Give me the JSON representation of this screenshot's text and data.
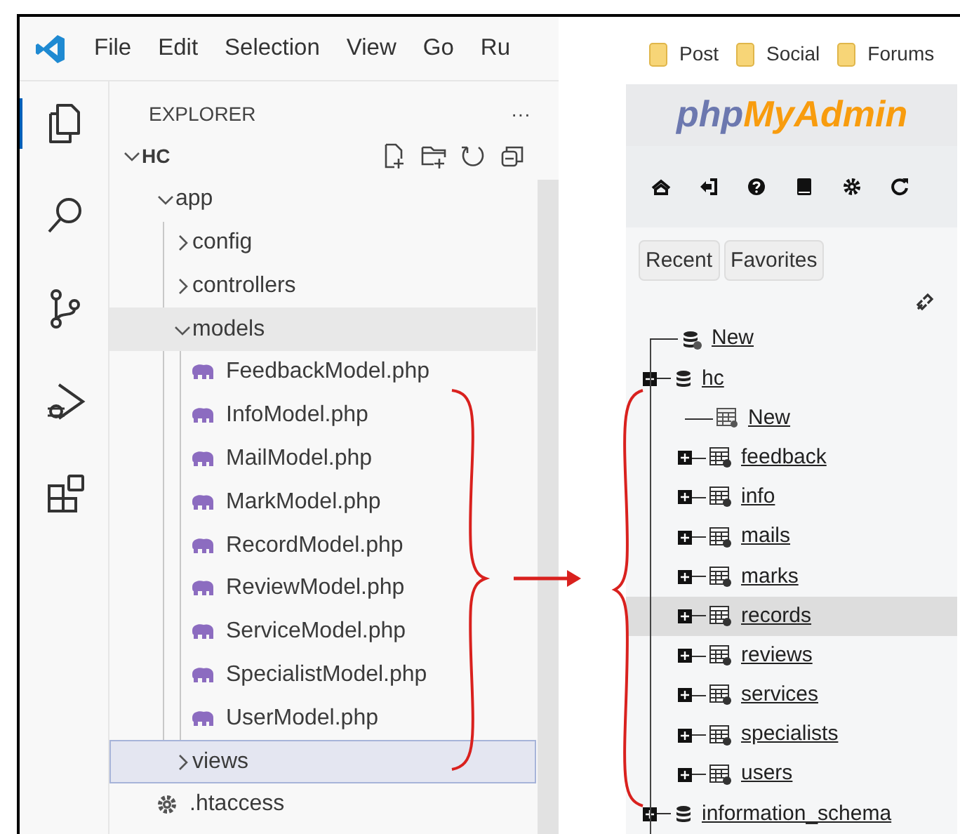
{
  "vscode": {
    "menu": [
      "File",
      "Edit",
      "Selection",
      "View",
      "Go",
      "Ru"
    ],
    "activity_bar": [
      {
        "selected": true
      },
      {
        "selected": false
      },
      {
        "selected": false
      },
      {
        "selected": false
      },
      {
        "selected": false
      }
    ],
    "explorer": {
      "title": "EXPLORER",
      "more": "···",
      "workspace": {
        "label": "HC",
        "expanded": true
      },
      "tree": [
        {
          "label": "app",
          "kind": "folder",
          "expanded": true,
          "selected": false,
          "hovered": false,
          "children": [
            {
              "label": "config",
              "kind": "folder",
              "expanded": false,
              "selected": false,
              "hovered": false
            },
            {
              "label": "controllers",
              "kind": "folder",
              "expanded": false,
              "selected": false,
              "hovered": false
            },
            {
              "label": "models",
              "kind": "folder",
              "expanded": true,
              "selected": false,
              "hovered": true,
              "children": [
                {
                  "label": "FeedbackModel.php",
                  "kind": "php",
                  "selected": false,
                  "hovered": false
                },
                {
                  "label": "InfoModel.php",
                  "kind": "php",
                  "selected": false,
                  "hovered": false
                },
                {
                  "label": "MailModel.php",
                  "kind": "php",
                  "selected": false,
                  "hovered": false
                },
                {
                  "label": "MarkModel.php",
                  "kind": "php",
                  "selected": false,
                  "hovered": false
                },
                {
                  "label": "RecordModel.php",
                  "kind": "php",
                  "selected": false,
                  "hovered": false
                },
                {
                  "label": "ReviewModel.php",
                  "kind": "php",
                  "selected": false,
                  "hovered": false
                },
                {
                  "label": "ServiceModel.php",
                  "kind": "php",
                  "selected": false,
                  "hovered": false
                },
                {
                  "label": "SpecialistModel.php",
                  "kind": "php",
                  "selected": false,
                  "hovered": false
                },
                {
                  "label": "UserModel.php",
                  "kind": "php",
                  "selected": false,
                  "hovered": false
                }
              ]
            },
            {
              "label": "views",
              "kind": "folder",
              "expanded": false,
              "selected": true,
              "hovered": false
            }
          ]
        },
        {
          "label": ".htaccess",
          "kind": "settings",
          "selected": false,
          "hovered": false
        }
      ]
    }
  },
  "phpmyadmin": {
    "bookmarks": [
      "Post",
      "Social",
      "Forums"
    ],
    "logo": [
      "php",
      "MyAdmin"
    ],
    "buttons": [
      "Recent",
      "Favorites"
    ],
    "tree": [
      {
        "label": "New",
        "kind": "new_database",
        "selected": false
      },
      {
        "label": "hc",
        "kind": "database",
        "expanded": true,
        "selected": false,
        "children": [
          {
            "label": "New",
            "kind": "new_table",
            "selected": false
          },
          {
            "label": "feedback",
            "kind": "table",
            "expanded": false,
            "selected": false
          },
          {
            "label": "info",
            "kind": "table",
            "expanded": false,
            "selected": false
          },
          {
            "label": "mails",
            "kind": "table",
            "expanded": false,
            "selected": false
          },
          {
            "label": "marks",
            "kind": "table",
            "expanded": false,
            "selected": false
          },
          {
            "label": "records",
            "kind": "table",
            "expanded": false,
            "selected": true
          },
          {
            "label": "reviews",
            "kind": "table",
            "expanded": false,
            "selected": false
          },
          {
            "label": "services",
            "kind": "table",
            "expanded": false,
            "selected": false
          },
          {
            "label": "specialists",
            "kind": "table",
            "expanded": false,
            "selected": false
          },
          {
            "label": "users",
            "kind": "table",
            "expanded": false,
            "selected": false
          }
        ]
      },
      {
        "label": "information_schema",
        "kind": "database",
        "expanded": false,
        "selected": false
      }
    ]
  }
}
